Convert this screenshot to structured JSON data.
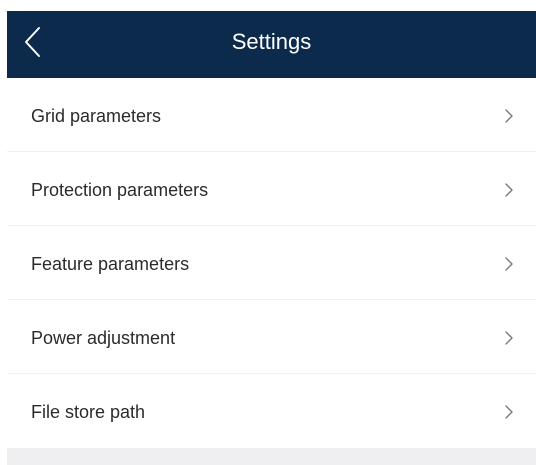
{
  "header": {
    "title": "Settings",
    "back_icon": "chevron-left-icon",
    "background_color": "#0b2a4c"
  },
  "settings": {
    "items": [
      {
        "label": "Grid parameters",
        "icon": "chevron-right-icon"
      },
      {
        "label": "Protection parameters",
        "icon": "chevron-right-icon"
      },
      {
        "label": "Feature parameters",
        "icon": "chevron-right-icon"
      },
      {
        "label": "Power adjustment",
        "icon": "chevron-right-icon"
      },
      {
        "label": "File store path",
        "icon": "chevron-right-icon"
      }
    ]
  }
}
